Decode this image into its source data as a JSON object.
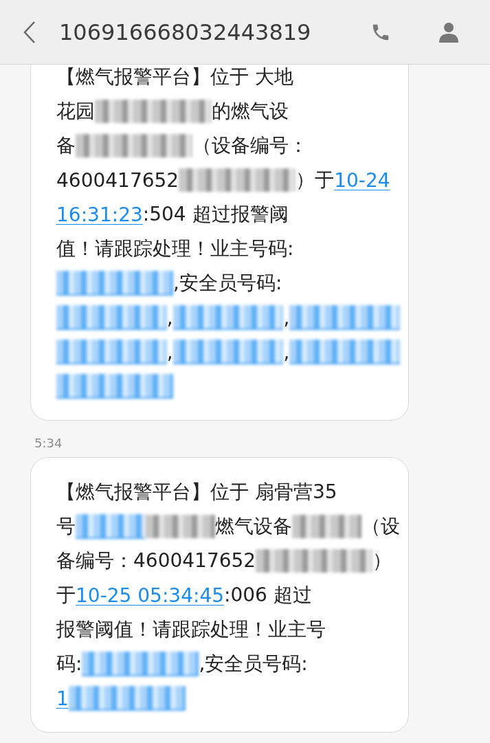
{
  "header": {
    "title": "106916668032443819"
  },
  "messages": [
    {
      "lines": [
        [
          {
            "kind": "text",
            "text": "【燃气报警平台】位于 大地"
          }
        ],
        [
          {
            "kind": "text",
            "text": "花园"
          },
          {
            "kind": "blur"
          },
          {
            "kind": "text",
            "text": "的燃气设"
          }
        ],
        [
          {
            "kind": "text",
            "text": "备"
          },
          {
            "kind": "blur"
          },
          {
            "kind": "text",
            "text": "（设备编号："
          }
        ],
        [
          {
            "kind": "text",
            "text": "4600417652"
          },
          {
            "kind": "blur"
          },
          {
            "kind": "text",
            "text": "）于 "
          },
          {
            "kind": "link",
            "text": "10-24"
          }
        ],
        [
          {
            "kind": "link",
            "text": "16:31:23"
          },
          {
            "kind": "text",
            "text": ":504  超过报警阈"
          }
        ],
        [
          {
            "kind": "text",
            "text": "值！请跟踪处理！业主号码:"
          }
        ],
        [
          {
            "kind": "bluelink"
          },
          {
            "kind": "text",
            "text": ",安全员号码:"
          }
        ],
        [
          {
            "kind": "bluelink"
          },
          {
            "kind": "text",
            "text": ","
          },
          {
            "kind": "bluelink"
          },
          {
            "kind": "text",
            "text": ","
          },
          {
            "kind": "bluelink"
          }
        ],
        [
          {
            "kind": "bluelink"
          },
          {
            "kind": "text",
            "text": ","
          },
          {
            "kind": "bluelink"
          },
          {
            "kind": "text",
            "text": ","
          },
          {
            "kind": "bluelink"
          }
        ],
        [
          {
            "kind": "bluelink"
          }
        ]
      ]
    },
    {
      "time": "5:34",
      "lines": [
        [
          {
            "kind": "text",
            "text": "【燃气报警平台】位于 扇骨营35"
          }
        ],
        [
          {
            "kind": "text",
            "text": "号"
          },
          {
            "kind": "bluelink"
          },
          {
            "kind": "blur"
          },
          {
            "kind": "text",
            "text": "燃气设备"
          },
          {
            "kind": "blur"
          },
          {
            "kind": "text",
            "text": "（设"
          }
        ],
        [
          {
            "kind": "text",
            "text": "备编号：4600417652"
          },
          {
            "kind": "blur"
          },
          {
            "kind": "text",
            "text": "）"
          }
        ],
        [
          {
            "kind": "text",
            "text": "于 "
          },
          {
            "kind": "link",
            "text": "10-25 05:34:45"
          },
          {
            "kind": "text",
            "text": ":006  超过"
          }
        ],
        [
          {
            "kind": "text",
            "text": "报警阈值！请跟踪处理！业主号"
          }
        ],
        [
          {
            "kind": "text",
            "text": "码:"
          },
          {
            "kind": "bluelink"
          },
          {
            "kind": "text",
            "text": ",安全员号码:"
          }
        ],
        [
          {
            "kind": "link",
            "text": "1"
          },
          {
            "kind": "bluelink"
          }
        ]
      ]
    }
  ]
}
